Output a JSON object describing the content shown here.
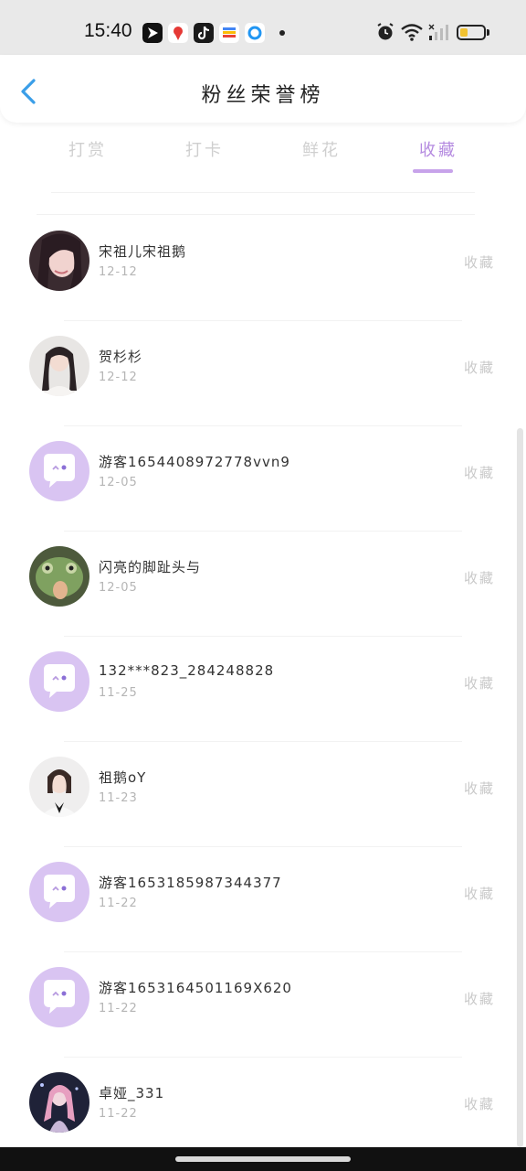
{
  "status_bar": {
    "time": "15:40",
    "app_icons": [
      "navigation-app-icon",
      "map-app-icon",
      "tiktok-app-icon",
      "wallet-app-icon",
      "browser-app-icon"
    ],
    "battery_level": 0.35
  },
  "header": {
    "title": "粉丝荣誉榜",
    "back_icon": "chevron-left-icon"
  },
  "tabs": [
    {
      "label": "打赏",
      "active": false
    },
    {
      "label": "打卡",
      "active": false
    },
    {
      "label": "鲜花",
      "active": false
    },
    {
      "label": "收藏",
      "active": true
    }
  ],
  "fans": [
    {
      "name": "宋祖儿宋祖鹅",
      "date": "12-12",
      "action": "收藏",
      "avatar": "photo"
    },
    {
      "name": "贺杉杉",
      "date": "12-12",
      "action": "收藏",
      "avatar": "photo"
    },
    {
      "name": "游客1654408972778vvn9",
      "date": "12-05",
      "action": "收藏",
      "avatar": "default"
    },
    {
      "name": "闪亮的脚趾头与",
      "date": "12-05",
      "action": "收藏",
      "avatar": "photo"
    },
    {
      "name": "132***823_284248828",
      "date": "11-25",
      "action": "收藏",
      "avatar": "default"
    },
    {
      "name": "祖鹅oY",
      "date": "11-23",
      "action": "收藏",
      "avatar": "photo"
    },
    {
      "name": "游客1653185987344377",
      "date": "11-22",
      "action": "收藏",
      "avatar": "default"
    },
    {
      "name": "游客1653164501169X620",
      "date": "11-22",
      "action": "收藏",
      "avatar": "default"
    },
    {
      "name": "卓娅_331",
      "date": "11-22",
      "action": "收藏",
      "avatar": "photo"
    }
  ],
  "colors": {
    "accent": "#b58be0",
    "back_arrow": "#3a9ee8",
    "default_avatar_bg": "#d9c4f2"
  }
}
